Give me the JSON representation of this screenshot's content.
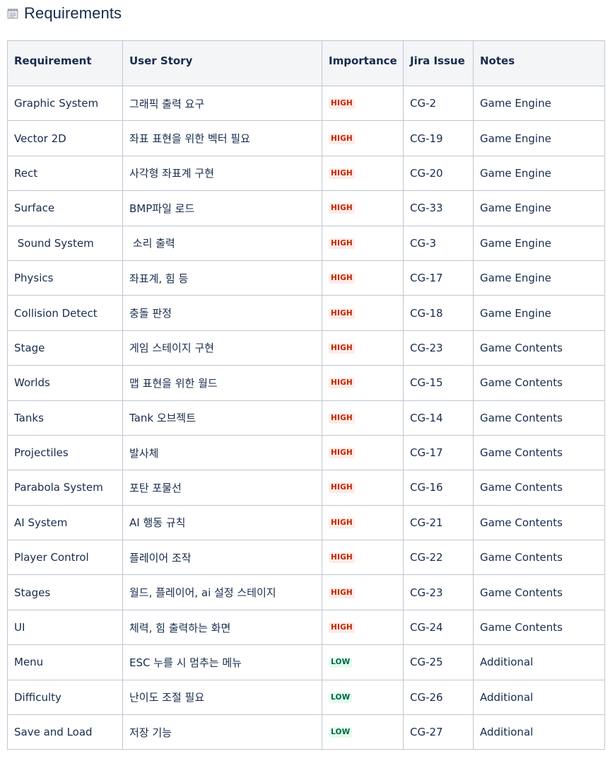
{
  "page": {
    "title": "Requirements",
    "title_icon": "notepad-icon"
  },
  "colors": {
    "text": "#172b4d",
    "header_bg": "#f4f5f7",
    "border": "#c1c7d0",
    "high_bg": "#ffebe6",
    "high_fg": "#bf2600",
    "low_bg": "#e3fcef",
    "low_fg": "#006644"
  },
  "table": {
    "headers": {
      "requirement": "Requirement",
      "user_story": "User Story",
      "importance": "Importance",
      "jira_issue": "Jira Issue",
      "notes": "Notes"
    },
    "rows": [
      {
        "requirement": "Graphic System",
        "user_story": "그래픽 출력 요구",
        "importance": "HIGH",
        "level": "high",
        "jira": "CG-2",
        "notes": "Game Engine"
      },
      {
        "requirement": "Vector 2D",
        "user_story": "좌표 표현을 위한 벡터 필요",
        "importance": "HIGH",
        "level": "high",
        "jira": "CG-19",
        "notes": "Game Engine"
      },
      {
        "requirement": "Rect",
        "user_story": "사각형 좌표계 구현",
        "importance": "HIGH",
        "level": "high",
        "jira": "CG-20",
        "notes": "Game Engine"
      },
      {
        "requirement": "Surface",
        "user_story": "BMP파일 로드",
        "importance": "HIGH",
        "level": "high",
        "jira": "CG-33",
        "notes": "Game Engine"
      },
      {
        "requirement": " Sound System",
        "user_story": " 소리 출력",
        "importance": "HIGH",
        "level": "high",
        "jira": "CG-3",
        "notes": "Game Engine"
      },
      {
        "requirement": "Physics",
        "user_story": "좌표계, 힘 등",
        "importance": "HIGH",
        "level": "high",
        "jira": "CG-17",
        "notes": "Game Engine"
      },
      {
        "requirement": "Collision Detect",
        "user_story": "충돌 판정",
        "importance": "HIGH",
        "level": "high",
        "jira": "CG-18",
        "notes": "Game Engine"
      },
      {
        "requirement": "Stage",
        "user_story": "게임 스테이지 구현",
        "importance": "HIGH",
        "level": "high",
        "jira": "CG-23",
        "notes": "Game Contents"
      },
      {
        "requirement": "Worlds",
        "user_story": "맵 표현을 위한 월드",
        "importance": "HIGH",
        "level": "high",
        "jira": "CG-15",
        "notes": "Game Contents"
      },
      {
        "requirement": "Tanks",
        "user_story": "Tank 오브젝트",
        "importance": "HIGH",
        "level": "high",
        "jira": "CG-14",
        "notes": "Game Contents"
      },
      {
        "requirement": "Projectiles",
        "user_story": "발사체",
        "importance": "HIGH",
        "level": "high",
        "jira": "CG-17",
        "notes": "Game Contents"
      },
      {
        "requirement": "Parabola System",
        "user_story": "포탄 포물선",
        "importance": "HIGH",
        "level": "high",
        "jira": "CG-16",
        "notes": "Game Contents"
      },
      {
        "requirement": "AI System",
        "user_story": "AI 행동 규칙",
        "importance": "HIGH",
        "level": "high",
        "jira": "CG-21",
        "notes": "Game Contents"
      },
      {
        "requirement": "Player Control",
        "user_story": "플레이어 조작",
        "importance": "HIGH",
        "level": "high",
        "jira": "CG-22",
        "notes": "Game Contents"
      },
      {
        "requirement": "Stages",
        "user_story": "월드, 플레이어, ai 설정 스테이지",
        "importance": "HIGH",
        "level": "high",
        "jira": "CG-23",
        "notes": "Game Contents"
      },
      {
        "requirement": "UI",
        "user_story": "체력, 힘 출력하는 화면",
        "importance": "HIGH",
        "level": "high",
        "jira": "CG-24",
        "notes": "Game Contents"
      },
      {
        "requirement": "Menu",
        "user_story": "ESC 누를 시 멈추는 메뉴",
        "importance": "LOW",
        "level": "low",
        "jira": "CG-25",
        "notes": "Additional"
      },
      {
        "requirement": "Difficulty",
        "user_story": "난이도 조절 필요",
        "importance": "LOW",
        "level": "low",
        "jira": "CG-26",
        "notes": "Additional"
      },
      {
        "requirement": "Save and Load",
        "user_story": "저장 기능",
        "importance": "LOW",
        "level": "low",
        "jira": "CG-27",
        "notes": "Additional"
      }
    ]
  }
}
